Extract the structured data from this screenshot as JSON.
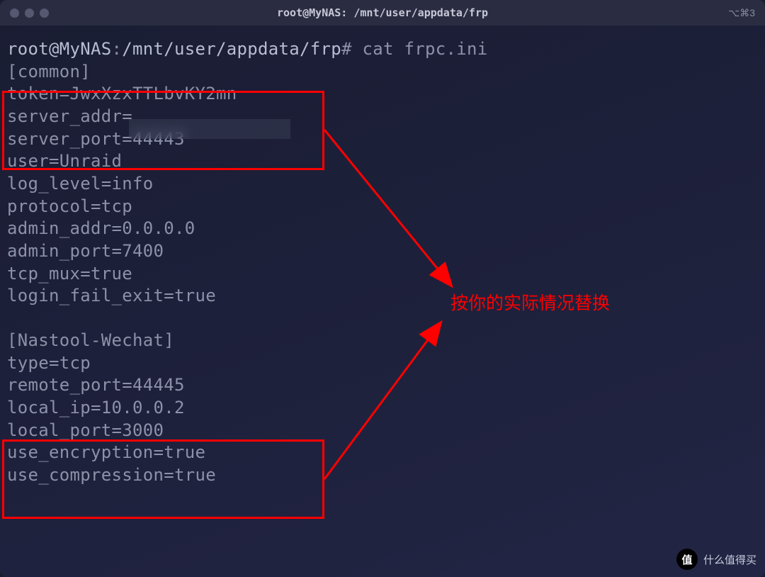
{
  "titlebar": {
    "title": "root@MyNAS: /mnt/user/appdata/frp",
    "shortcut": "⌥⌘3"
  },
  "prompt": {
    "user_host": "root@MyNAS",
    "colon": ":",
    "path": "/mnt/user/appdata/frp",
    "hash": "#",
    "command": "cat frpc.ini"
  },
  "lines": {
    "l0": "[common]",
    "l1": "token=JwxXzxTTLbvKY2mn",
    "l2": "server_addr=",
    "l3": "server_port=44443",
    "l4": "user=Unraid",
    "l5": "log_level=info",
    "l6": "protocol=tcp",
    "l7": "admin_addr=0.0.0.0",
    "l8": "admin_port=7400",
    "l9": "tcp_mux=true",
    "l10": "login_fail_exit=true",
    "l11": "[Nastool-Wechat]",
    "l12": "type=tcp",
    "l13": "remote_port=44445",
    "l14": "local_ip=10.0.0.2",
    "l15": "local_port=3000",
    "l16": "use_encryption=true",
    "l17": "use_compression=true"
  },
  "annotation": "按你的实际情况替换",
  "watermark": {
    "badge": "值",
    "text": "什么值得买"
  }
}
